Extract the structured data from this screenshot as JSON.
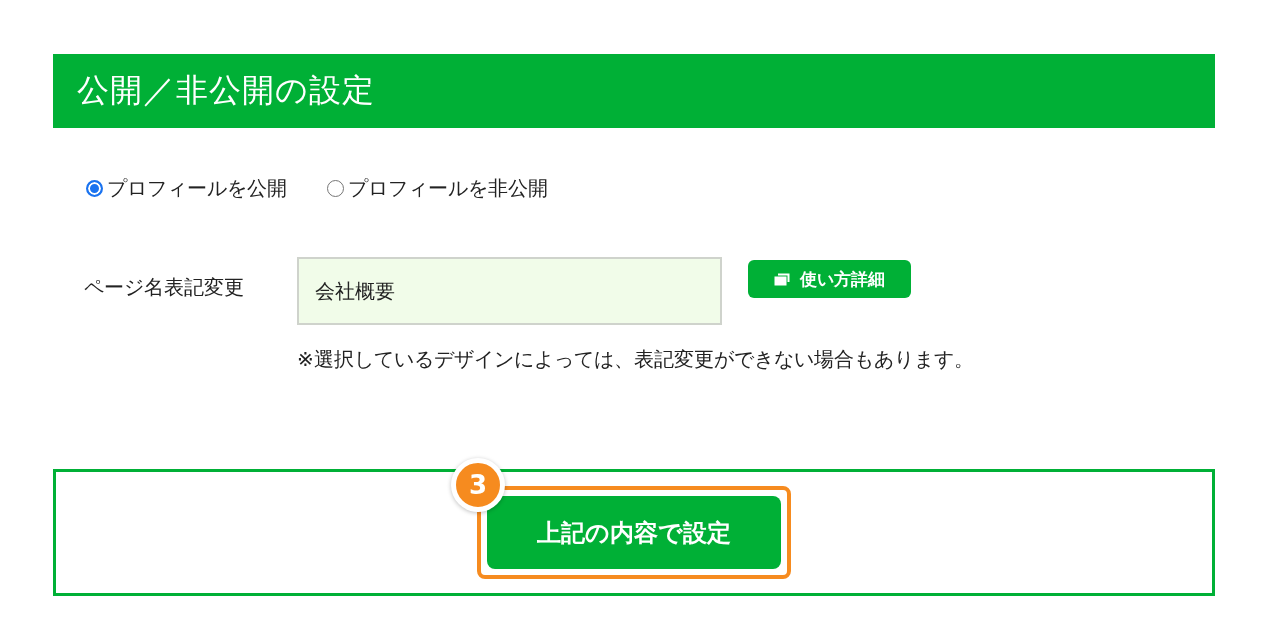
{
  "section": {
    "title": "公開／非公開の設定"
  },
  "visibility": [
    {
      "label": "プロフィールを公開",
      "selected": true
    },
    {
      "label": "プロフィールを非公開",
      "selected": false
    }
  ],
  "page_name": {
    "label": "ページ名表記変更",
    "value": "会社概要"
  },
  "help_button": {
    "label": "使い方詳細"
  },
  "note": "※選択しているデザインによっては、表記変更ができない場合もあります。",
  "submit": {
    "label": "上記の内容で設定",
    "step_badge": "3",
    "highlighted": true
  }
}
